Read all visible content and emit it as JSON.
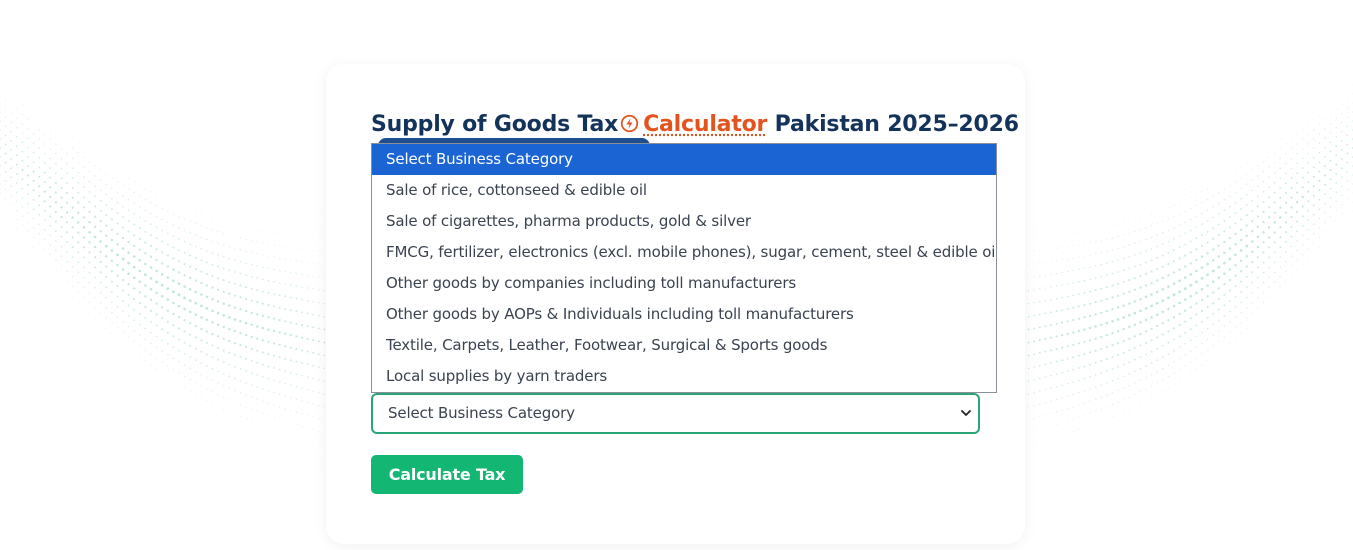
{
  "title": {
    "part1": "Supply of Goods Tax",
    "link": "Calculator",
    "part2": "Pakistan 2025–2026"
  },
  "category_select": {
    "selected_label": "Select Business Category",
    "options": [
      "Select Business Category",
      "Sale of rice, cottonseed & edible oil",
      "Sale of cigarettes, pharma products, gold & silver",
      "FMCG, fertilizer, electronics (excl. mobile phones), sugar, cement, steel & edible oil",
      "Other goods by companies including toll manufacturers",
      "Other goods by AOPs & Individuals including toll manufacturers",
      "Textile, Carpets, Leather, Footwear, Surgical & Sports goods",
      "Local supplies by yarn traders"
    ],
    "highlighted_index": 0
  },
  "actions": {
    "calculate_label": "Calculate Tax"
  },
  "colors": {
    "title": "#14335a",
    "accent_orange": "#e2531e",
    "highlight_blue": "#1a64d4",
    "button_green": "#14b673",
    "select_border": "#2aa578",
    "dots": "#b9e4cf"
  },
  "icons": {
    "title_icon": "bolt-circle-icon",
    "select_icon": "chevron-down-icon"
  }
}
